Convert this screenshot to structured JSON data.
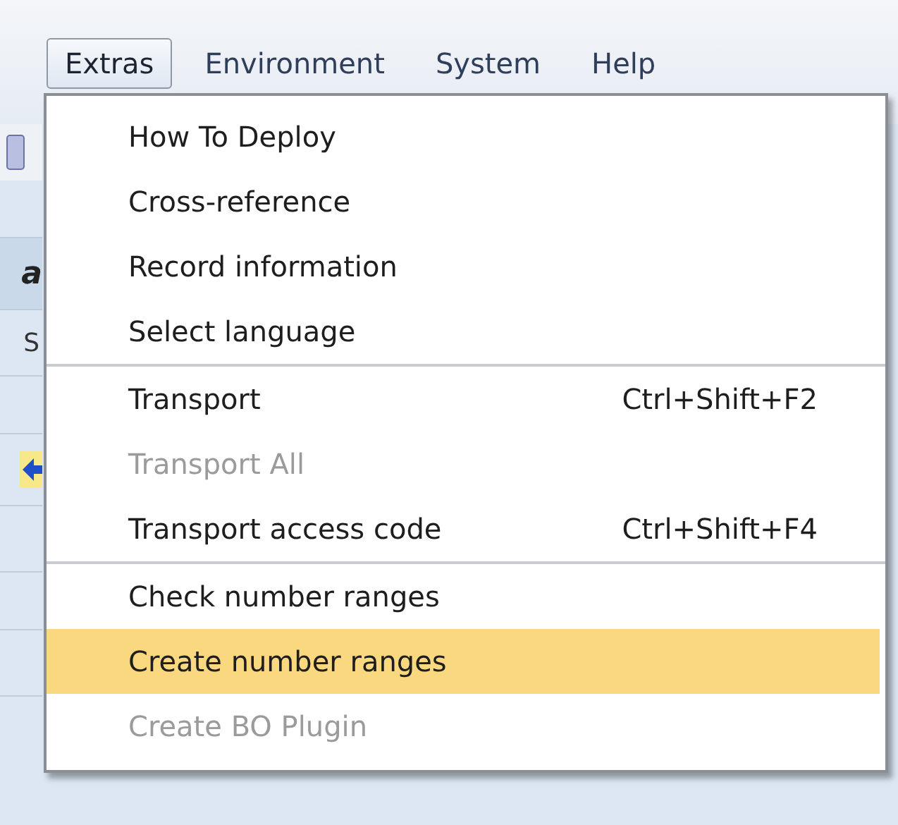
{
  "menu_bar": [
    {
      "label": "Extras",
      "selected": true
    },
    {
      "label": "Environment",
      "selected": false
    },
    {
      "label": "System",
      "selected": false
    },
    {
      "label": "Help",
      "selected": false
    }
  ],
  "background_fragments": [
    "a",
    "S"
  ],
  "dropdown_menu": {
    "groups": [
      [
        {
          "label": "How To Deploy",
          "disabled": false,
          "selected": false
        },
        {
          "label": "Cross-reference",
          "disabled": false,
          "selected": false
        },
        {
          "label": "Record information",
          "disabled": false,
          "selected": false
        },
        {
          "label": "Select language",
          "disabled": false,
          "selected": false
        }
      ],
      [
        {
          "label": "Transport",
          "shortcut": "Ctrl+Shift+F2",
          "disabled": false,
          "selected": false
        },
        {
          "label": "Transport All",
          "disabled": true,
          "selected": false
        },
        {
          "label": "Transport access code",
          "shortcut": "Ctrl+Shift+F4",
          "disabled": false,
          "selected": false
        }
      ],
      [
        {
          "label": "Check number ranges",
          "disabled": false,
          "selected": false
        },
        {
          "label": "Create number ranges",
          "disabled": false,
          "selected": true
        },
        {
          "label": "Create BO Plugin",
          "disabled": true,
          "selected": false
        }
      ]
    ]
  }
}
